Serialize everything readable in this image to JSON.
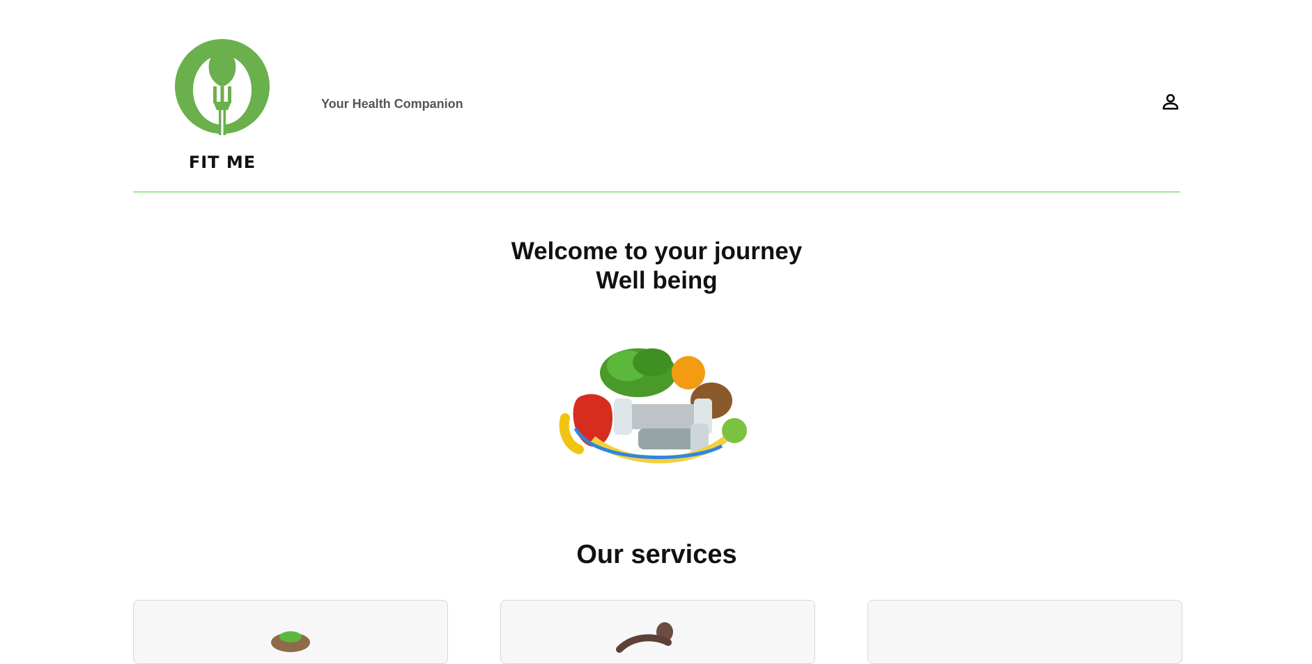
{
  "header": {
    "logo_text": "FIT ME",
    "tagline": "Your Health Companion",
    "profile_icon": "person-icon",
    "divider_color": "#4cd137"
  },
  "hero": {
    "title_line1": "Welcome to your journey",
    "title_line2": "Well being",
    "image": "fruits-vegetables-dumbbells-image"
  },
  "services": {
    "title": "Our services",
    "cards": [
      {
        "image": "salad-bowl-image"
      },
      {
        "image": "fitness-person-image"
      },
      {
        "image": ""
      }
    ]
  },
  "colors": {
    "brand_green": "#6ab04c",
    "accent_green": "#4cd137"
  }
}
